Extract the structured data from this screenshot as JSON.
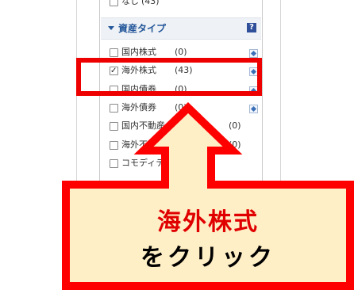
{
  "filter_panel": {
    "top_item": {
      "label": "なし",
      "count": "(43)",
      "checked": false
    },
    "section": {
      "title": "資産タイプ",
      "help_label": "?"
    },
    "items": [
      {
        "label": "国内株式",
        "count": "(0)",
        "checked": false,
        "expand": true
      },
      {
        "label": "海外株式",
        "count": "(43)",
        "checked": true,
        "expand": true
      },
      {
        "label": "国内債券",
        "count": "(0)",
        "checked": false,
        "expand": true
      },
      {
        "label": "海外債券",
        "count": "(0)",
        "checked": false,
        "expand": true
      },
      {
        "label": "国内不動産（リート）",
        "count": "(0)",
        "checked": false,
        "expand": false
      },
      {
        "label": "海外不動産（リート）",
        "count": "(0)",
        "checked": false,
        "expand": false
      },
      {
        "label": "コモディティ",
        "count": "",
        "checked": false,
        "expand": false
      }
    ]
  },
  "callout": {
    "line1": "海外株式",
    "line2": "をクリック"
  },
  "colors": {
    "highlight_red": "#ef0000",
    "callout_bg": "#ffefc6",
    "section_text": "#24579a"
  }
}
